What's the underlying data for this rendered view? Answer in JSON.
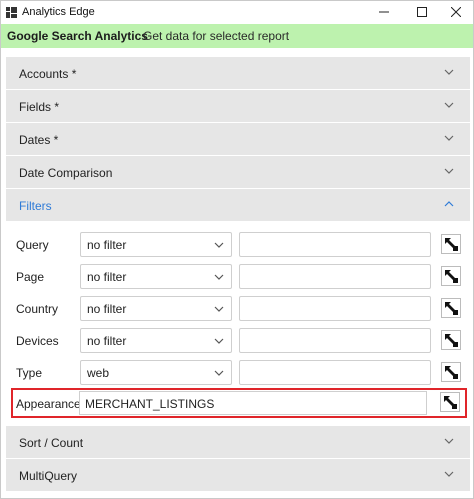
{
  "window": {
    "title": "Analytics Edge",
    "app_icon": "analytics-edge-app-icon",
    "controls": [
      "minimize-icon",
      "maximize-icon",
      "close-icon"
    ]
  },
  "banner": {
    "title": "Google Search Analytics",
    "subtitle": "Get data for selected report",
    "color": "#bdf2ae"
  },
  "sections": [
    {
      "label": "Accounts *",
      "expanded": false
    },
    {
      "label": "Fields *",
      "expanded": false
    },
    {
      "label": "Dates *",
      "expanded": false
    },
    {
      "label": "Date Comparison",
      "expanded": false
    },
    {
      "label": "Filters",
      "expanded": true
    },
    {
      "label": "Sort / Count",
      "expanded": false
    },
    {
      "label": "MultiQuery",
      "expanded": false
    }
  ],
  "filters": [
    {
      "label": "Query",
      "operator": "no filter",
      "value": ""
    },
    {
      "label": "Page",
      "operator": "no filter",
      "value": ""
    },
    {
      "label": "Country",
      "operator": "no filter",
      "value": ""
    },
    {
      "label": "Devices",
      "operator": "no filter",
      "value": ""
    },
    {
      "label": "Type",
      "operator": "web",
      "value": ""
    }
  ],
  "appearance": {
    "label": "Appearance",
    "value": "MERCHANT_LISTINGS"
  },
  "colors": {
    "active_section": "#2f7bd7",
    "section_bg": "#e6e6e6",
    "highlight_border": "#e0252a"
  }
}
